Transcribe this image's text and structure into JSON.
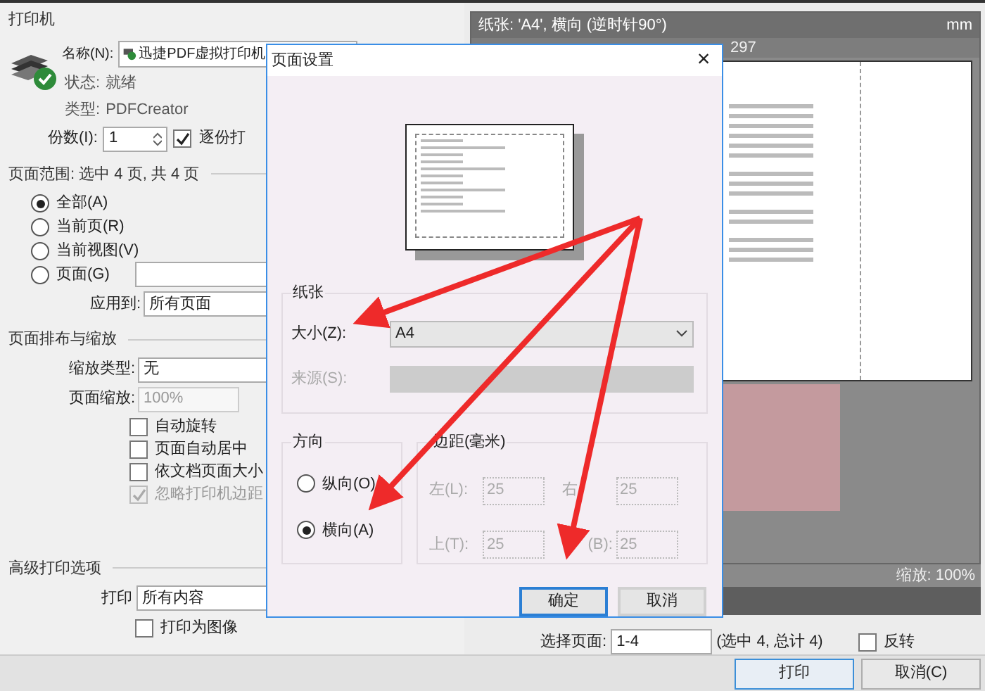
{
  "printer": {
    "title": "打印机",
    "name_label": "名称(N):",
    "name_value": "迅捷PDF虚拟打印机",
    "status_label": "状态:",
    "status_value": "就绪",
    "type_label": "类型:",
    "type_value": "PDFCreator",
    "copies_label": "份数(I):",
    "copies_value": "1",
    "collate": {
      "label": "逐份打",
      "checked": true
    }
  },
  "page_range": {
    "title": "页面范围: 选中 4 页, 共 4 页",
    "options": [
      {
        "label": "全部(A)",
        "selected": true
      },
      {
        "label": "当前页(R)",
        "selected": false
      },
      {
        "label": "当前视图(V)",
        "selected": false
      },
      {
        "label": "页面(G)",
        "selected": false
      }
    ],
    "apply_label": "应用到:",
    "apply_value": "所有页面"
  },
  "layout": {
    "title": "页面排布与缩放",
    "scale_type_label": "缩放类型:",
    "scale_type_value": "无",
    "scale_label": "页面缩放:",
    "scale_value": "100%",
    "options": [
      {
        "label": "自动旋转",
        "checked": false,
        "disabled": false
      },
      {
        "label": "页面自动居中",
        "checked": false,
        "disabled": false
      },
      {
        "label": "依文档页面大小",
        "checked": false,
        "disabled": false
      },
      {
        "label": "忽略打印机边距",
        "checked": true,
        "disabled": true
      }
    ]
  },
  "advanced": {
    "title": "高级打印选项",
    "print_label": "打印",
    "print_value": "所有内容",
    "as_image": {
      "label": "打印为图像",
      "checked": false
    }
  },
  "preview": {
    "header": "纸张: 'A4', 横向 (逆时针90°)",
    "unit": "mm",
    "ruler_label": "297",
    "zoom": "缩放: 100%",
    "pages_label": "选择页面:",
    "pages_value": "1-4",
    "pages_count": "(选中 4, 总计 4)",
    "reverse": {
      "label": "反转",
      "checked": false
    }
  },
  "buttons": [
    {
      "label": "打印",
      "focused": true
    },
    {
      "label": "取消(C)",
      "focused": false
    }
  ],
  "dialog": {
    "title": "页面设置",
    "close": "×",
    "paper": {
      "title": "纸张",
      "size_label": "大小(Z):",
      "size_value": "A4",
      "source_label": "来源(S):"
    },
    "orientation": {
      "title": "方向",
      "options": [
        {
          "label": "纵向(O)",
          "selected": false
        },
        {
          "label": "横向(A)",
          "selected": true
        }
      ]
    },
    "margins": {
      "title": "边距(毫米)",
      "fields": [
        {
          "label": "左(L):",
          "value": "25"
        },
        {
          "label": "右",
          "value": "25"
        },
        {
          "label": "上(T):",
          "value": "25"
        },
        {
          "label": "(B):",
          "value": "25"
        }
      ]
    },
    "buttons": [
      {
        "label": "确定",
        "focused": true
      },
      {
        "label": "取消",
        "focused": false
      }
    ]
  }
}
